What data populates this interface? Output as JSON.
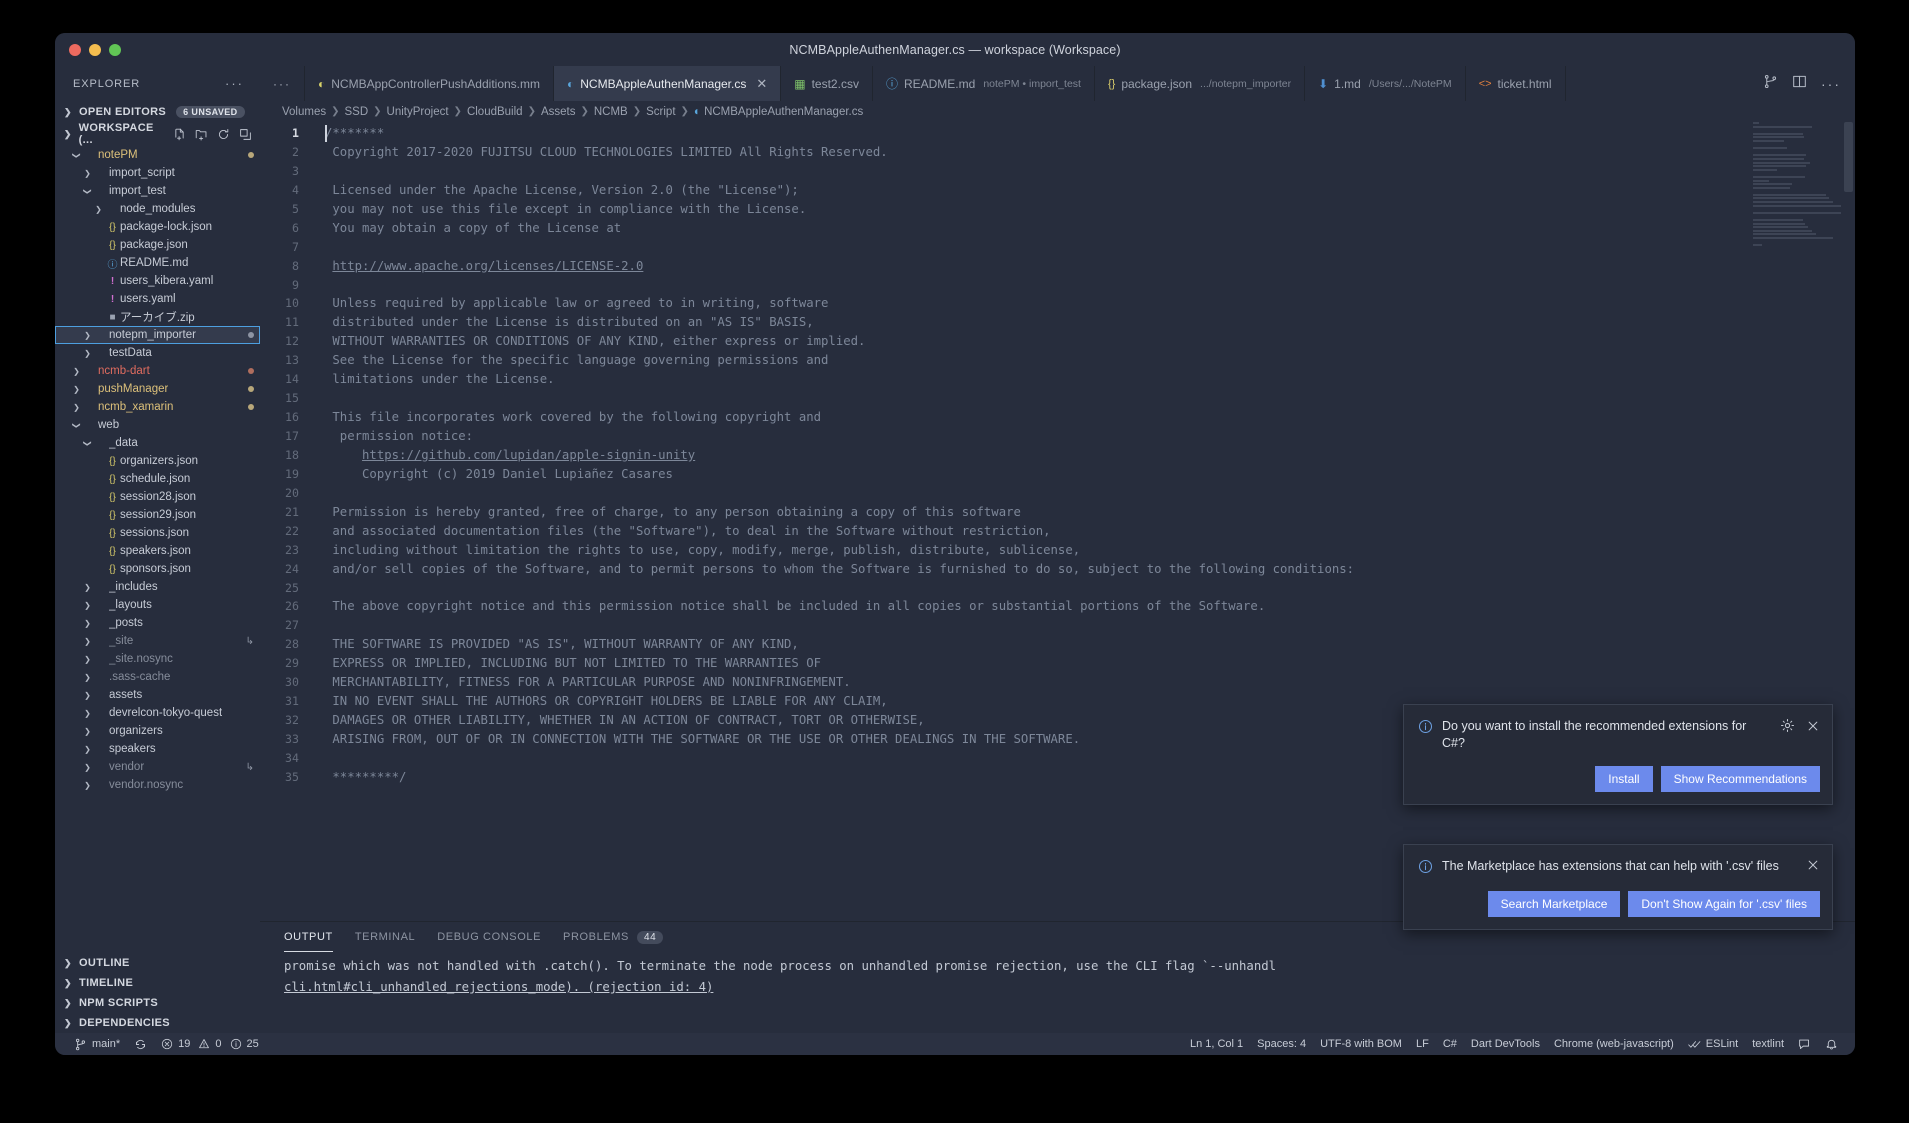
{
  "window": {
    "title": "NCMBAppleAuthenManager.cs — workspace (Workspace)"
  },
  "sidebar": {
    "header": "EXPLORER",
    "sections": [
      {
        "label": "OPEN EDITORS",
        "badge": "6 UNSAVED",
        "expanded": false
      },
      {
        "label": "WORKSPACE (...",
        "badge": "",
        "expanded": true
      }
    ],
    "tree": [
      {
        "name": "notePM",
        "indent": 1,
        "arrow": "down",
        "icon": "none",
        "style": "folder-yellow",
        "dot": "#b8a77a"
      },
      {
        "name": "import_script",
        "indent": 2,
        "arrow": "right",
        "icon": "none",
        "style": "normal",
        "dot": ""
      },
      {
        "name": "import_test",
        "indent": 2,
        "arrow": "down",
        "icon": "none",
        "style": "normal",
        "dot": ""
      },
      {
        "name": "node_modules",
        "indent": 3,
        "arrow": "right",
        "icon": "none",
        "style": "normal",
        "dot": ""
      },
      {
        "name": "package-lock.json",
        "indent": 3,
        "arrow": "none",
        "icon": "json",
        "style": "normal",
        "dot": ""
      },
      {
        "name": "package.json",
        "indent": 3,
        "arrow": "none",
        "icon": "json",
        "style": "normal",
        "dot": ""
      },
      {
        "name": "README.md",
        "indent": 3,
        "arrow": "none",
        "icon": "md",
        "style": "normal",
        "dot": ""
      },
      {
        "name": "users_kibera.yaml",
        "indent": 3,
        "arrow": "none",
        "icon": "yaml",
        "style": "normal",
        "dot": ""
      },
      {
        "name": "users.yaml",
        "indent": 3,
        "arrow": "none",
        "icon": "yaml",
        "style": "normal",
        "dot": ""
      },
      {
        "name": "アーカイブ.zip",
        "indent": 3,
        "arrow": "none",
        "icon": "zip",
        "style": "normal",
        "dot": ""
      },
      {
        "name": "notepm_importer",
        "indent": 2,
        "arrow": "right",
        "icon": "none",
        "style": "selected",
        "dot": "#8d94a3"
      },
      {
        "name": "testData",
        "indent": 2,
        "arrow": "right",
        "icon": "none",
        "style": "normal",
        "dot": ""
      },
      {
        "name": "ncmb-dart",
        "indent": 1,
        "arrow": "right",
        "icon": "none",
        "style": "folder-red",
        "dot": "#b06e5e"
      },
      {
        "name": "pushManager",
        "indent": 1,
        "arrow": "right",
        "icon": "none",
        "style": "folder-yellow",
        "dot": "#b8a77a"
      },
      {
        "name": "ncmb_xamarin",
        "indent": 1,
        "arrow": "right",
        "icon": "none",
        "style": "folder-yellow",
        "dot": "#b8a77a"
      },
      {
        "name": "web",
        "indent": 1,
        "arrow": "down",
        "icon": "none",
        "style": "normal",
        "dot": ""
      },
      {
        "name": "_data",
        "indent": 2,
        "arrow": "down",
        "icon": "none",
        "style": "normal",
        "dot": ""
      },
      {
        "name": "organizers.json",
        "indent": 3,
        "arrow": "none",
        "icon": "json",
        "style": "normal",
        "dot": ""
      },
      {
        "name": "schedule.json",
        "indent": 3,
        "arrow": "none",
        "icon": "json",
        "style": "normal",
        "dot": ""
      },
      {
        "name": "session28.json",
        "indent": 3,
        "arrow": "none",
        "icon": "json",
        "style": "normal",
        "dot": ""
      },
      {
        "name": "session29.json",
        "indent": 3,
        "arrow": "none",
        "icon": "json",
        "style": "normal",
        "dot": ""
      },
      {
        "name": "sessions.json",
        "indent": 3,
        "arrow": "none",
        "icon": "json",
        "style": "normal",
        "dot": ""
      },
      {
        "name": "speakers.json",
        "indent": 3,
        "arrow": "none",
        "icon": "json",
        "style": "normal",
        "dot": ""
      },
      {
        "name": "sponsors.json",
        "indent": 3,
        "arrow": "none",
        "icon": "json",
        "style": "normal",
        "dot": ""
      },
      {
        "name": "_includes",
        "indent": 2,
        "arrow": "right",
        "icon": "none",
        "style": "normal",
        "dot": ""
      },
      {
        "name": "_layouts",
        "indent": 2,
        "arrow": "right",
        "icon": "none",
        "style": "normal",
        "dot": ""
      },
      {
        "name": "_posts",
        "indent": 2,
        "arrow": "right",
        "icon": "none",
        "style": "normal",
        "dot": ""
      },
      {
        "name": "_site",
        "indent": 2,
        "arrow": "right",
        "icon": "none",
        "style": "dim",
        "dot": "",
        "symlink": true
      },
      {
        "name": "_site.nosync",
        "indent": 2,
        "arrow": "right",
        "icon": "none",
        "style": "dim",
        "dot": ""
      },
      {
        "name": ".sass-cache",
        "indent": 2,
        "arrow": "right",
        "icon": "none",
        "style": "dim",
        "dot": ""
      },
      {
        "name": "assets",
        "indent": 2,
        "arrow": "right",
        "icon": "none",
        "style": "normal",
        "dot": ""
      },
      {
        "name": "devrelcon-tokyo-quest",
        "indent": 2,
        "arrow": "right",
        "icon": "none",
        "style": "normal",
        "dot": ""
      },
      {
        "name": "organizers",
        "indent": 2,
        "arrow": "right",
        "icon": "none",
        "style": "normal",
        "dot": ""
      },
      {
        "name": "speakers",
        "indent": 2,
        "arrow": "right",
        "icon": "none",
        "style": "normal",
        "dot": ""
      },
      {
        "name": "vendor",
        "indent": 2,
        "arrow": "right",
        "icon": "none",
        "style": "dim",
        "dot": "",
        "symlink": true
      },
      {
        "name": "vendor.nosync",
        "indent": 2,
        "arrow": "right",
        "icon": "none",
        "style": "dim",
        "dot": ""
      }
    ],
    "bottom_sections": [
      "OUTLINE",
      "TIMELINE",
      "NPM SCRIPTS",
      "DEPENDENCIES"
    ]
  },
  "tabs": [
    {
      "label": "NCMBAppControllerPushAdditions.mm",
      "sub": "",
      "icon": "c-sharp-green",
      "active": false,
      "closable": false
    },
    {
      "label": "NCMBAppleAuthenManager.cs",
      "sub": "",
      "icon": "c-sharp-blue",
      "active": true,
      "closable": true
    },
    {
      "label": "test2.csv",
      "sub": "",
      "icon": "csv-green",
      "active": false,
      "closable": false
    },
    {
      "label": "README.md",
      "sub": "notePM • import_test",
      "icon": "md-blue",
      "active": false,
      "closable": false
    },
    {
      "label": "package.json",
      "sub": ".../notepm_importer",
      "icon": "json-yellow",
      "active": false,
      "closable": false
    },
    {
      "label": "1.md",
      "sub": "/Users/.../NotePM",
      "icon": "md-download-blue",
      "active": false,
      "closable": false
    },
    {
      "label": "ticket.html",
      "sub": "",
      "icon": "html-orange",
      "active": false,
      "closable": false
    }
  ],
  "breadcrumb": [
    "Volumes",
    "SSD",
    "UnityProject",
    "CloudBuild",
    "Assets",
    "NCMB",
    "Script",
    "NCMBAppleAuthenManager.cs"
  ],
  "editor": {
    "lines": [
      {
        "n": 1,
        "text": "/*******",
        "current": true
      },
      {
        "n": 2,
        "text": " Copyright 2017-2020 FUJITSU CLOUD TECHNOLOGIES LIMITED All Rights Reserved."
      },
      {
        "n": 3,
        "text": ""
      },
      {
        "n": 4,
        "text": " Licensed under the Apache License, Version 2.0 (the \"License\");"
      },
      {
        "n": 5,
        "text": " you may not use this file except in compliance with the License."
      },
      {
        "n": 6,
        "text": " You may obtain a copy of the License at"
      },
      {
        "n": 7,
        "text": ""
      },
      {
        "n": 8,
        "text": " http://www.apache.org/licenses/LICENSE-2.0",
        "link": true
      },
      {
        "n": 9,
        "text": ""
      },
      {
        "n": 10,
        "text": " Unless required by applicable law or agreed to in writing, software"
      },
      {
        "n": 11,
        "text": " distributed under the License is distributed on an \"AS IS\" BASIS,"
      },
      {
        "n": 12,
        "text": " WITHOUT WARRANTIES OR CONDITIONS OF ANY KIND, either express or implied."
      },
      {
        "n": 13,
        "text": " See the License for the specific language governing permissions and"
      },
      {
        "n": 14,
        "text": " limitations under the License."
      },
      {
        "n": 15,
        "text": ""
      },
      {
        "n": 16,
        "text": " This file incorporates work covered by the following copyright and"
      },
      {
        "n": 17,
        "text": "  permission notice:"
      },
      {
        "n": 18,
        "text": "     https://github.com/lupidan/apple-signin-unity",
        "link": true
      },
      {
        "n": 19,
        "text": "     Copyright (c) 2019 Daniel Lupiañez Casares"
      },
      {
        "n": 20,
        "text": ""
      },
      {
        "n": 21,
        "text": " Permission is hereby granted, free of charge, to any person obtaining a copy of this software"
      },
      {
        "n": 22,
        "text": " and associated documentation files (the \"Software\"), to deal in the Software without restriction,"
      },
      {
        "n": 23,
        "text": " including without limitation the rights to use, copy, modify, merge, publish, distribute, sublicense,"
      },
      {
        "n": 24,
        "text": " and/or sell copies of the Software, and to permit persons to whom the Software is furnished to do so, subject to the following conditions:"
      },
      {
        "n": 25,
        "text": ""
      },
      {
        "n": 26,
        "text": " The above copyright notice and this permission notice shall be included in all copies or substantial portions of the Software."
      },
      {
        "n": 27,
        "text": ""
      },
      {
        "n": 28,
        "text": " THE SOFTWARE IS PROVIDED \"AS IS\", WITHOUT WARRANTY OF ANY KIND,"
      },
      {
        "n": 29,
        "text": " EXPRESS OR IMPLIED, INCLUDING BUT NOT LIMITED TO THE WARRANTIES OF"
      },
      {
        "n": 30,
        "text": " MERCHANTABILITY, FITNESS FOR A PARTICULAR PURPOSE AND NONINFRINGEMENT."
      },
      {
        "n": 31,
        "text": " IN NO EVENT SHALL THE AUTHORS OR COPYRIGHT HOLDERS BE LIABLE FOR ANY CLAIM,"
      },
      {
        "n": 32,
        "text": " DAMAGES OR OTHER LIABILITY, WHETHER IN AN ACTION OF CONTRACT, TORT OR OTHERWISE,"
      },
      {
        "n": 33,
        "text": " ARISING FROM, OUT OF OR IN CONNECTION WITH THE SOFTWARE OR THE USE OR OTHER DEALINGS IN THE SOFTWARE."
      },
      {
        "n": 34,
        "text": ""
      },
      {
        "n": 35,
        "text": " *********/"
      }
    ]
  },
  "notifications": [
    {
      "message": "Do you want to install the recommended extensions for C#?",
      "buttons": [
        "Install",
        "Show Recommendations"
      ],
      "has_gear": true
    },
    {
      "message": "The Marketplace has extensions that can help with '.csv' files",
      "buttons": [
        "Search Marketplace",
        "Don't Show Again for '.csv' files"
      ],
      "has_gear": false
    }
  ],
  "panel": {
    "tabs": [
      {
        "label": "OUTPUT",
        "active": true,
        "badge": ""
      },
      {
        "label": "TERMINAL",
        "active": false,
        "badge": ""
      },
      {
        "label": "DEBUG CONSOLE",
        "active": false,
        "badge": ""
      },
      {
        "label": "PROBLEMS",
        "active": false,
        "badge": "44"
      }
    ],
    "content_line1": "promise which was not handled with .catch(). To terminate the node process on unhandled promise rejection, use the CLI flag `--unhandl",
    "content_line2": "cli.html#cli_unhandled_rejections_mode). (rejection id: 4)"
  },
  "status": {
    "branch": "main*",
    "errors": "19",
    "warnings": "0",
    "infos": "25",
    "cursor": "Ln 1, Col 1",
    "spaces": "Spaces: 4",
    "encoding": "UTF-8 with BOM",
    "eol": "LF",
    "language": "C#",
    "dart_devtools": "Dart DevTools",
    "chrome": "Chrome (web-javascript)",
    "eslint": "ESLint",
    "textlint": "textlint"
  },
  "colors": {
    "accent": "#6c8aec",
    "selection": "#4d9fe0",
    "bg": "#272d3d"
  }
}
